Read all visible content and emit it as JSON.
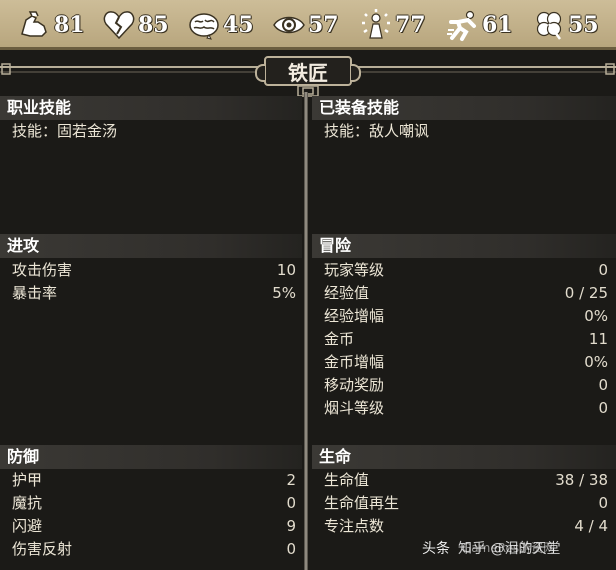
{
  "stats": [
    {
      "icon": "strength-arm-icon",
      "value": "81"
    },
    {
      "icon": "broken-heart-icon",
      "value": "85"
    },
    {
      "icon": "brain-icon",
      "value": "45"
    },
    {
      "icon": "eye-icon",
      "value": "57"
    },
    {
      "icon": "radiant-figure-icon",
      "value": "77"
    },
    {
      "icon": "running-figure-icon",
      "value": "61"
    },
    {
      "icon": "clover-icon",
      "value": "55"
    }
  ],
  "class_title": "铁匠",
  "sections": {
    "job_skill": {
      "title": "职业技能",
      "rows": [
        {
          "label": "技能：固若金汤"
        }
      ]
    },
    "equipped_skill": {
      "title": "已装备技能",
      "rows": [
        {
          "label": "技能：敌人嘲讽"
        }
      ]
    },
    "offense": {
      "title": "进攻",
      "rows": [
        {
          "label": "攻击伤害",
          "value": "10"
        },
        {
          "label": "暴击率",
          "value": "5%"
        }
      ]
    },
    "adventure": {
      "title": "冒险",
      "rows": [
        {
          "label": "玩家等级",
          "value": "0"
        },
        {
          "label": "经验值",
          "value": "0 / 25"
        },
        {
          "label": "经验增幅",
          "value": "0%"
        },
        {
          "label": "金币",
          "value": "11"
        },
        {
          "label": "金币增幅",
          "value": "0%"
        },
        {
          "label": "移动奖励",
          "value": "0"
        },
        {
          "label": "烟斗等级",
          "value": "0"
        }
      ]
    },
    "defense": {
      "title": "防御",
      "rows": [
        {
          "label": "护甲",
          "value": "2"
        },
        {
          "label": "魔抗",
          "value": "0"
        },
        {
          "label": "闪避",
          "value": "9"
        },
        {
          "label": "伤害反射",
          "value": "0"
        }
      ]
    },
    "life": {
      "title": "生命",
      "rows": [
        {
          "label": "生命值",
          "value": "38 / 38"
        },
        {
          "label": "生命值再生",
          "value": "0"
        },
        {
          "label": "专注点数",
          "value": "4 / 4"
        }
      ]
    }
  },
  "watermark": {
    "left": "头条",
    "right": "知乎 @泪的天堂",
    "mid": "GameRes游资网"
  },
  "colors": {
    "stat_bar": "#cdbd98",
    "header_bg": "#3b3935",
    "panel_bg": "#1b1a17",
    "text": "#ece6d6"
  }
}
